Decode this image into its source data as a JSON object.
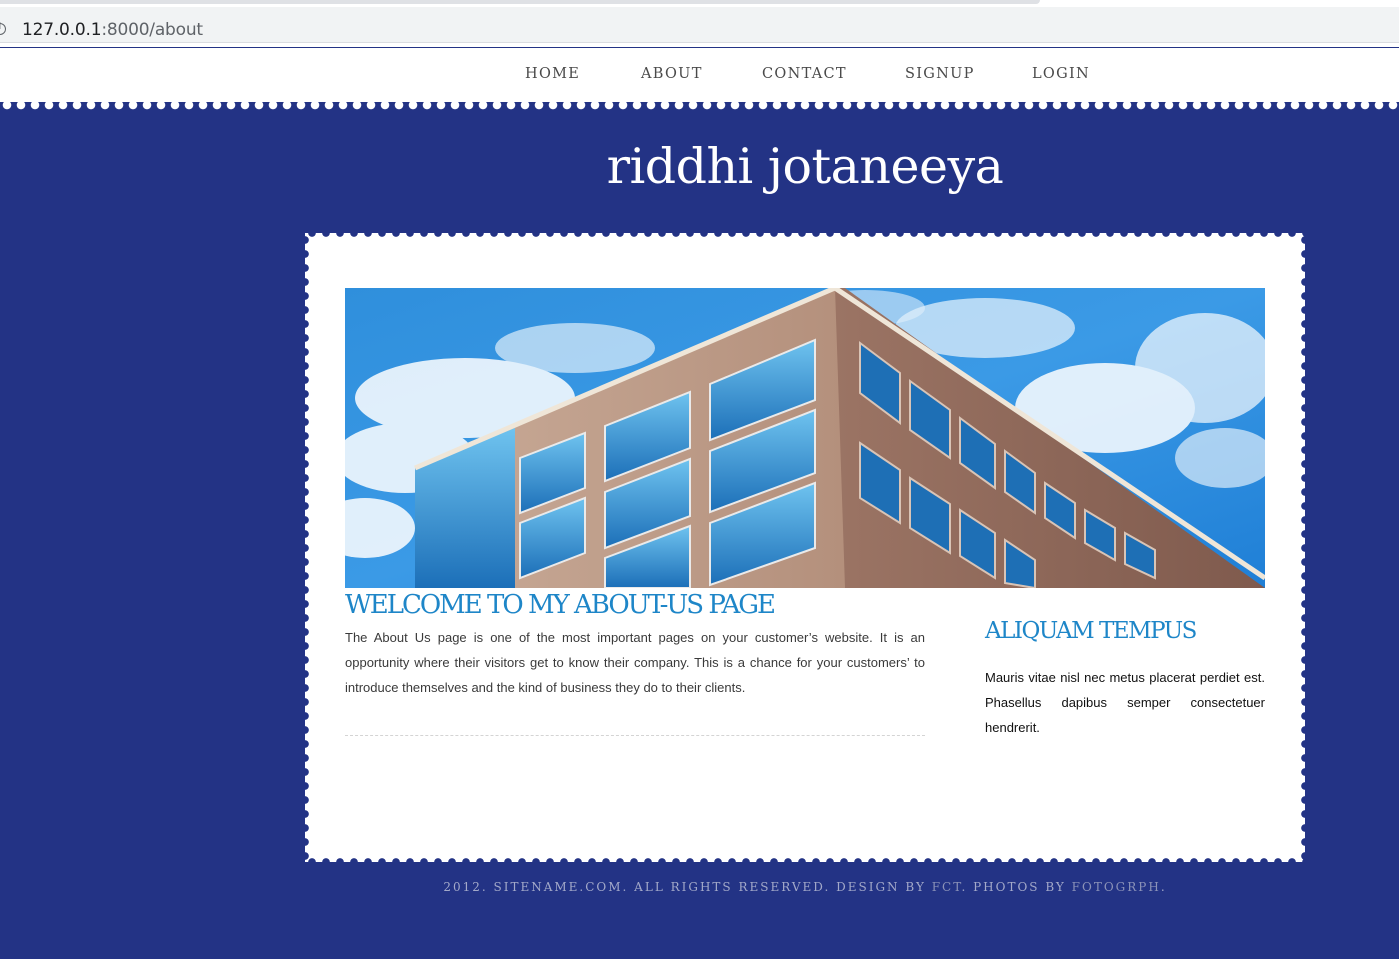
{
  "browser": {
    "url_host": "127.0.0.1",
    "url_path": ":8000/about"
  },
  "nav": {
    "items": [
      {
        "label": "HOME"
      },
      {
        "label": "ABOUT"
      },
      {
        "label": "CONTACT"
      },
      {
        "label": "SIGNUP"
      },
      {
        "label": "LOGIN"
      }
    ]
  },
  "site": {
    "title": "riddhi jotaneeya"
  },
  "main": {
    "heading": "WELCOME TO MY ABOUT-US PAGE",
    "body": "The About Us page is one of the most important pages on your customer’s website. It is an opportunity where their visitors get to know their company. This is a chance for your customers’ to introduce themselves and the kind of business they do to their clients."
  },
  "sidebar": {
    "heading": "ALIQUAM TEMPUS",
    "body": "Mauris vitae nisl nec metus placerat perdiet est. Phasellus dapibus semper consectetuer hendrerit."
  },
  "footer": {
    "prefix": "2012. SITENAME.COM. ALL RIGHTS RESERVED. DESIGN BY ",
    "design_link": "FCT",
    "middle": ". PHOTOS BY ",
    "photos_link": "FOTOGRPH",
    "suffix": "."
  },
  "colors": {
    "background": "#233385",
    "accent": "#1e86c8"
  }
}
